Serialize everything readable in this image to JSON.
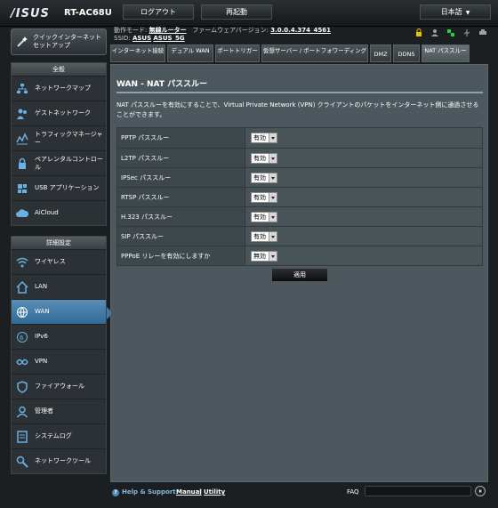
{
  "header": {
    "logo": "/ISUS",
    "model": "RT-AC68U",
    "logout_label": "ログアウト",
    "reboot_label": "再起動",
    "language": "日本語"
  },
  "status": {
    "op_mode_label": "動作モード:",
    "op_mode_value": "無線ルーター",
    "firmware_label": "ファームウェアバージョン:",
    "firmware_value": "3.0.0.4.374_4561",
    "ssid_label": "SSID:",
    "ssid_2g": "ASUS",
    "ssid_5g": "ASUS_5G"
  },
  "sidebar": {
    "quick_setup": "クイックインターネットセットアップ",
    "general_header": "全般",
    "general_items": [
      {
        "label": "ネットワークマップ",
        "icon": "network-map-icon"
      },
      {
        "label": "ゲストネットワーク",
        "icon": "guest-network-icon"
      },
      {
        "label": "トラフィックマネージャー",
        "icon": "traffic-manager-icon"
      },
      {
        "label": "ペアレンタルコントロール",
        "icon": "parental-control-icon"
      },
      {
        "label": "USB アプリケーション",
        "icon": "usb-app-icon"
      },
      {
        "label": "AiCloud",
        "icon": "aicloud-icon"
      }
    ],
    "advanced_header": "詳細設定",
    "advanced_items": [
      {
        "label": "ワイヤレス",
        "icon": "wireless-icon"
      },
      {
        "label": "LAN",
        "icon": "lan-icon"
      },
      {
        "label": "WAN",
        "icon": "wan-icon"
      },
      {
        "label": "IPv6",
        "icon": "ipv6-icon"
      },
      {
        "label": "VPN",
        "icon": "vpn-icon"
      },
      {
        "label": "ファイアウォール",
        "icon": "firewall-icon"
      },
      {
        "label": "管理者",
        "icon": "admin-icon"
      },
      {
        "label": "システムログ",
        "icon": "system-log-icon"
      },
      {
        "label": "ネットワークツール",
        "icon": "network-tools-icon"
      }
    ]
  },
  "tabs": [
    "インターネット接続",
    "デュアル WAN",
    "ポートトリガー",
    "仮想サーバー / ポートフォワーディング",
    "DMZ",
    "DDNS",
    "NAT パススルー"
  ],
  "main": {
    "title": "WAN - NAT パススルー",
    "description": "NAT パススルーを有効にすることで、Virtual Private Network (VPN) クライアントのパケットをインターネット側に通過させることができます。",
    "rows": [
      {
        "label": "PPTP パススルー",
        "value": "有効"
      },
      {
        "label": "L2TP パススルー",
        "value": "有効"
      },
      {
        "label": "IPSec パススルー",
        "value": "有効"
      },
      {
        "label": "RTSP パススルー",
        "value": "有効"
      },
      {
        "label": "H.323 パススルー",
        "value": "有効"
      },
      {
        "label": "SIP パススルー",
        "value": "有効"
      },
      {
        "label": "PPPoE リレーを有効にしますか",
        "value": "無効"
      }
    ],
    "apply_label": "適用"
  },
  "footer": {
    "help": "Help & Support",
    "manual": "Manual",
    "separator": "|",
    "utility": "Utility",
    "faq": "FAQ"
  }
}
